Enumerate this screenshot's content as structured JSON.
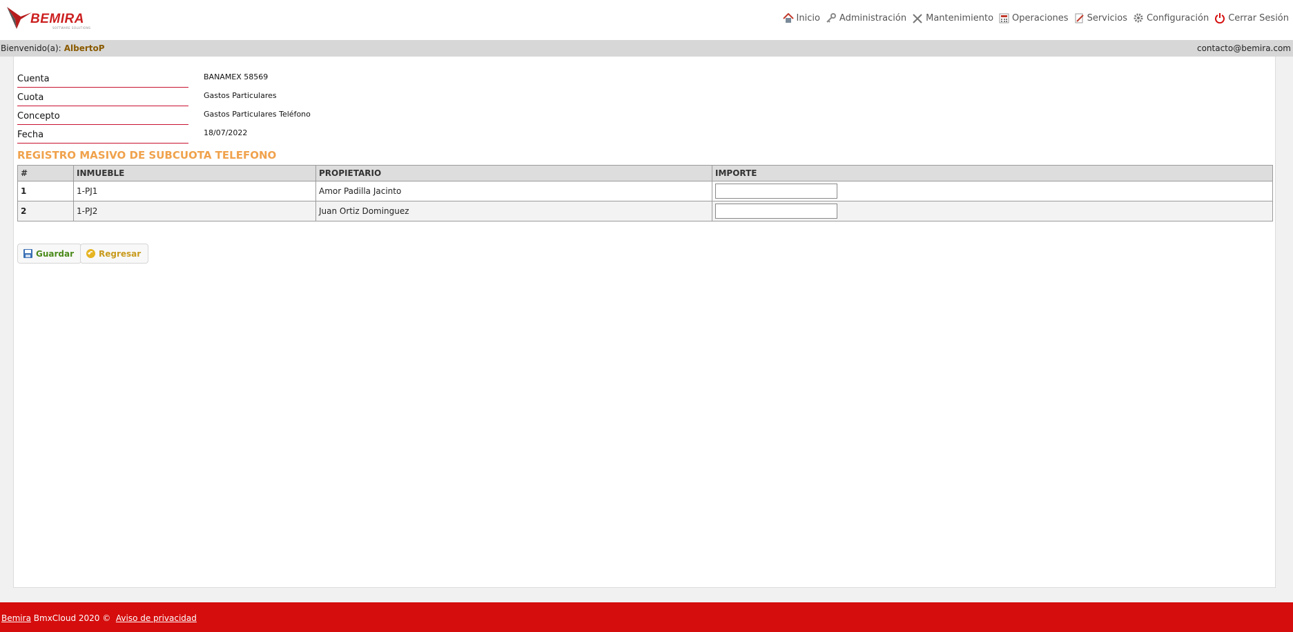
{
  "brand": {
    "name": "BEMIRA",
    "tagline": "SOFTWARE SOLUTIONS"
  },
  "nav": {
    "items": [
      {
        "label": "Inicio",
        "icon": "home-icon"
      },
      {
        "label": "Administración",
        "icon": "key-icon"
      },
      {
        "label": "Mantenimiento",
        "icon": "tools-icon"
      },
      {
        "label": "Operaciones",
        "icon": "calculator-icon"
      },
      {
        "label": "Servicios",
        "icon": "document-edit-icon"
      },
      {
        "label": "Configuración",
        "icon": "gear-icon"
      },
      {
        "label": "Cerrar Sesión",
        "icon": "power-icon"
      }
    ]
  },
  "welcome": {
    "prefix": "Bienvenido(a):",
    "user": "AlbertoP",
    "email": "contacto@bemira.com"
  },
  "form": {
    "fields": [
      {
        "label": "Cuenta",
        "value": "BANAMEX 58569"
      },
      {
        "label": "Cuota",
        "value": "Gastos Particulares"
      },
      {
        "label": "Concepto",
        "value": "Gastos Particulares Teléfono"
      },
      {
        "label": "Fecha",
        "value": "18/07/2022"
      }
    ],
    "section_title": "REGISTRO MASIVO DE SUBCUOTA TELEFONO"
  },
  "table": {
    "headers": [
      "#",
      "INMUEBLE",
      "PROPIETARIO",
      "IMPORTE"
    ],
    "rows": [
      {
        "num": "1",
        "inmueble": "1-PJ1",
        "propietario": "Amor Padilla Jacinto",
        "importe": ""
      },
      {
        "num": "2",
        "inmueble": "1-PJ2",
        "propietario": "Juan Ortiz Dominguez",
        "importe": ""
      }
    ]
  },
  "buttons": {
    "save": "Guardar",
    "back": "Regresar"
  },
  "footer": {
    "brand_link": "Bemira",
    "text": "BmxCloud 2020 ©",
    "privacy_link": "Aviso de privacidad"
  },
  "colors": {
    "accent_red": "#d50d0d",
    "section_orange": "#f0a24c",
    "user_brown": "#8a5a00",
    "save_green": "#4a8a1a",
    "back_gold": "#c89a1e"
  }
}
